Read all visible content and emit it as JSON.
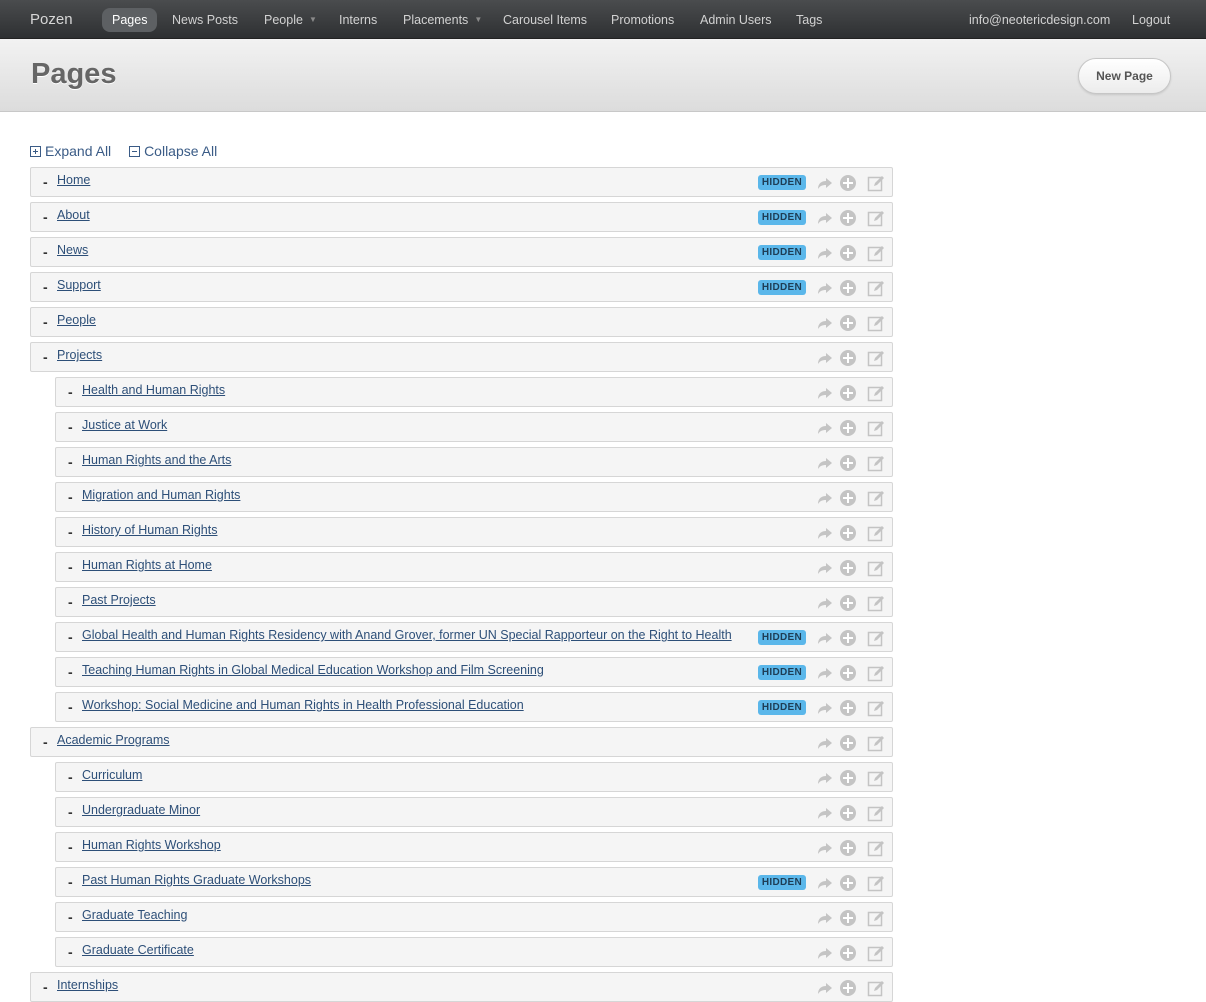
{
  "navbar": {
    "brand": "Pozen",
    "items": [
      {
        "label": "Pages",
        "active": true,
        "caret": false
      },
      {
        "label": "News Posts",
        "active": false,
        "caret": false
      },
      {
        "label": "People",
        "active": false,
        "caret": true
      },
      {
        "label": "Interns",
        "active": false,
        "caret": false
      },
      {
        "label": "Placements",
        "active": false,
        "caret": true
      },
      {
        "label": "Carousel Items",
        "active": false,
        "caret": false
      },
      {
        "label": "Promotions",
        "active": false,
        "caret": false
      },
      {
        "label": "Admin Users",
        "active": false,
        "caret": false
      },
      {
        "label": "Tags",
        "active": false,
        "caret": false
      }
    ],
    "user_email": "info@neotericdesign.com",
    "logout_label": "Logout"
  },
  "header": {
    "title": "Pages",
    "new_page_label": "New Page"
  },
  "tree_controls": {
    "expand_all": "Expand All",
    "collapse_all": "Collapse All"
  },
  "hidden_badge_label": "HIDDEN",
  "colors": {
    "link": "#2d4f78",
    "badge": "#5bb7ea",
    "navbar": "#3b3d3f"
  },
  "pages": [
    {
      "title": "Home",
      "depth": 0,
      "hidden": true
    },
    {
      "title": "About",
      "depth": 0,
      "hidden": true
    },
    {
      "title": "News",
      "depth": 0,
      "hidden": true
    },
    {
      "title": "Support",
      "depth": 0,
      "hidden": true
    },
    {
      "title": "People",
      "depth": 0,
      "hidden": false
    },
    {
      "title": "Projects",
      "depth": 0,
      "hidden": false
    },
    {
      "title": "Health and Human Rights",
      "depth": 1,
      "hidden": false
    },
    {
      "title": "Justice at Work",
      "depth": 1,
      "hidden": false
    },
    {
      "title": "Human Rights and the Arts",
      "depth": 1,
      "hidden": false
    },
    {
      "title": "Migration and Human Rights",
      "depth": 1,
      "hidden": false
    },
    {
      "title": "History of Human Rights",
      "depth": 1,
      "hidden": false
    },
    {
      "title": "Human Rights at Home",
      "depth": 1,
      "hidden": false
    },
    {
      "title": "Past Projects",
      "depth": 1,
      "hidden": false
    },
    {
      "title": "Global Health and Human Rights Residency with Anand Grover, former UN Special Rapporteur on the Right to Health",
      "depth": 1,
      "hidden": true
    },
    {
      "title": "Teaching Human Rights in Global Medical Education Workshop and Film Screening",
      "depth": 1,
      "hidden": true
    },
    {
      "title": "Workshop: Social Medicine and Human Rights in Health Professional Education",
      "depth": 1,
      "hidden": true
    },
    {
      "title": "Academic Programs",
      "depth": 0,
      "hidden": false
    },
    {
      "title": "Curriculum",
      "depth": 1,
      "hidden": false
    },
    {
      "title": "Undergraduate Minor",
      "depth": 1,
      "hidden": false
    },
    {
      "title": "Human Rights Workshop",
      "depth": 1,
      "hidden": false
    },
    {
      "title": "Past Human Rights Graduate Workshops",
      "depth": 1,
      "hidden": true
    },
    {
      "title": "Graduate Teaching",
      "depth": 1,
      "hidden": false
    },
    {
      "title": "Graduate Certificate",
      "depth": 1,
      "hidden": false
    },
    {
      "title": "Internships",
      "depth": 0,
      "hidden": false
    }
  ]
}
